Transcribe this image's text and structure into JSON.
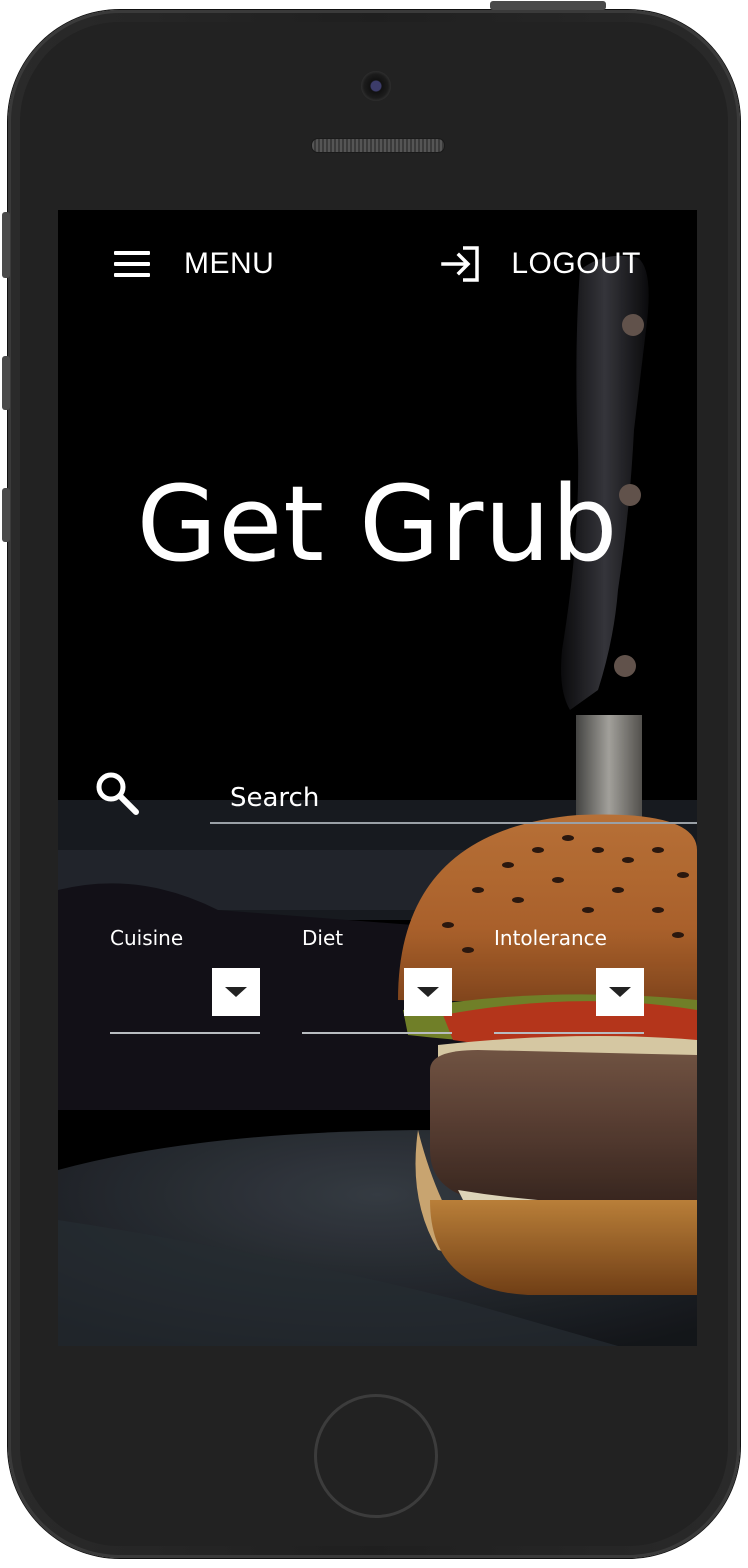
{
  "header": {
    "menu_label": "MENU",
    "menu_icon": "hamburger-icon",
    "logout_label": "LOGOUT",
    "logout_icon": "logout-arrow-icon"
  },
  "hero": {
    "title": "Get Grub"
  },
  "search": {
    "placeholder": "Search",
    "icon": "search-icon"
  },
  "filters": [
    {
      "label": "Cuisine",
      "icon": "caret-down-icon"
    },
    {
      "label": "Diet",
      "icon": "caret-down-icon"
    },
    {
      "label": "Intolerance",
      "icon": "caret-down-icon"
    }
  ],
  "colors": {
    "background": "#000000",
    "text": "#ffffff",
    "underline": "#9aa0a6",
    "phone_body": "#222222"
  }
}
